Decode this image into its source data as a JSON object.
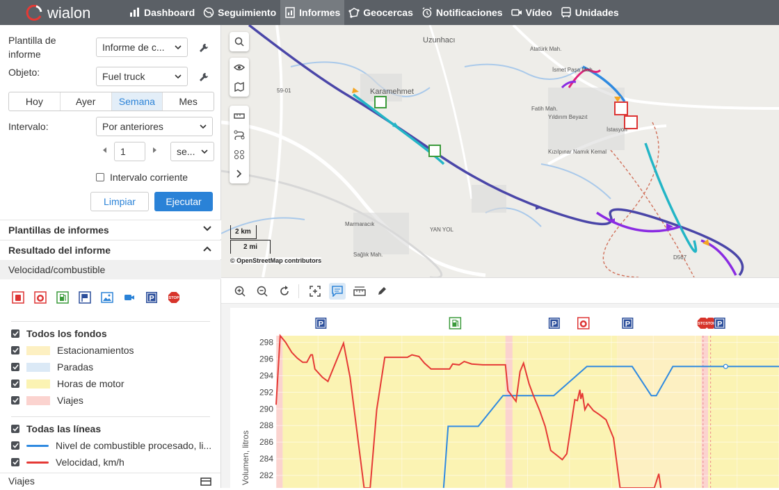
{
  "app": {
    "logo_text": "wialon"
  },
  "nav": [
    {
      "label": "Dashboard",
      "icon": "bar-chart-icon"
    },
    {
      "label": "Seguimiento",
      "icon": "globe-icon"
    },
    {
      "label": "Informes",
      "icon": "report-icon",
      "active": true
    },
    {
      "label": "Geocercas",
      "icon": "geofence-icon"
    },
    {
      "label": "Notificaciones",
      "icon": "alarm-icon"
    },
    {
      "label": "Vídeo",
      "icon": "video-icon"
    },
    {
      "label": "Unidades",
      "icon": "bus-icon"
    }
  ],
  "form": {
    "template_label": "Plantilla de informe",
    "template_value": "Informe de c...",
    "object_label": "Objeto:",
    "object_value": "Fuel truck",
    "periods": [
      "Hoy",
      "Ayer",
      "Semana",
      "Mes"
    ],
    "active_period": "Semana",
    "interval_label": "Intervalo:",
    "interval_value": "Por anteriores",
    "interval_count": "1",
    "interval_unit": "se...",
    "current_interval_label": "Intervalo corriente",
    "clear_label": "Limpiar",
    "run_label": "Ejecutar"
  },
  "sections": {
    "templates": "Plantillas de informes",
    "result": "Resultado del informe",
    "result_item": "Velocidad/combustible",
    "trips": "Viajes"
  },
  "event_icons": [
    "fuel-drain-icon",
    "fuel-sensor-icon",
    "fuel-station-icon",
    "flag-icon",
    "image-icon",
    "video-icon",
    "parking-icon",
    "stop-icon"
  ],
  "backgrounds": {
    "all_label": "Todos los fondos",
    "items": [
      {
        "label": "Estacionamientos",
        "color": "#fdf0c2"
      },
      {
        "label": "Paradas",
        "color": "#dbe9f6"
      },
      {
        "label": "Horas de motor",
        "color": "#fbf3b3"
      },
      {
        "label": "Viajes",
        "color": "#fbd3cf"
      }
    ]
  },
  "lines": {
    "all_label": "Todas las líneas",
    "items": [
      {
        "label": "Nivel de combustible procesado, li...",
        "color": "#2f8ae0"
      },
      {
        "label": "Velocidad, km/h",
        "color": "#e53935"
      }
    ]
  },
  "map": {
    "labels": [
      "Uzunhacı",
      "Karamehmet",
      "Atatürk Mah.",
      "İsmet Paşa Mah.",
      "Fatih Mah.",
      "Yıldırım Beyazıt",
      "İstasyon",
      "Kızılpınar Namık Kemal",
      "Marmaracık",
      "Sağlık Mah.",
      "59-01",
      "D567",
      "YAN YOL"
    ],
    "scale_km": "2 km",
    "scale_mi": "2 mi",
    "attribution": "© OpenStreetMap contributors"
  },
  "chart_data": {
    "type": "line",
    "ylabel": "Volumen, litros",
    "yticks": [
      282,
      284,
      286,
      288,
      290,
      292,
      294,
      296,
      298
    ],
    "ylim": [
      280.5,
      298.8
    ],
    "xlim": [
      0,
      100
    ],
    "series": [
      {
        "color": "#2f8ae0",
        "points": [
          [
            33.3,
            280.5
          ],
          [
            34.2,
            287.9
          ],
          [
            40.2,
            287.9
          ],
          [
            45.1,
            291.6
          ],
          [
            55.2,
            291.6
          ],
          [
            61.8,
            295.1
          ],
          [
            70.8,
            295.1
          ],
          [
            74.6,
            291.6
          ],
          [
            75.6,
            291.6
          ],
          [
            78.9,
            295.1
          ],
          [
            100,
            295.1
          ]
        ]
      },
      {
        "color": "#e53935",
        "points": [
          [
            0,
            290.5
          ],
          [
            0.8,
            298.8
          ],
          [
            1.9,
            298.0
          ],
          [
            3.1,
            296.8
          ],
          [
            4.2,
            296.1
          ],
          [
            5.3,
            295.6
          ],
          [
            6.1,
            295.6
          ],
          [
            6.9,
            296.5
          ],
          [
            7.2,
            296.5
          ],
          [
            7.7,
            294.8
          ],
          [
            9.2,
            293.8
          ],
          [
            10.3,
            293.3
          ],
          [
            13.4,
            297.9
          ],
          [
            14.7,
            293.8
          ],
          [
            17.5,
            280.5
          ],
          [
            18.7,
            280.5
          ],
          [
            20.0,
            289.9
          ],
          [
            21.6,
            296.2
          ],
          [
            26.1,
            296.2
          ],
          [
            27.0,
            296.5
          ],
          [
            28.4,
            296.3
          ],
          [
            29.5,
            295.5
          ],
          [
            30.8,
            294.8
          ],
          [
            31.6,
            294.8
          ],
          [
            34.5,
            294.8
          ],
          [
            35.1,
            295.4
          ],
          [
            36.4,
            295.3
          ],
          [
            37.4,
            295.7
          ],
          [
            38.9,
            295.4
          ],
          [
            41.1,
            295.3
          ],
          [
            45.6,
            295.3
          ],
          [
            46.1,
            292.2
          ],
          [
            47.7,
            290.9
          ],
          [
            48.5,
            294.5
          ],
          [
            49.2,
            295.5
          ],
          [
            50.3,
            293.0
          ],
          [
            51.1,
            291.7
          ],
          [
            52.4,
            289.8
          ],
          [
            53.5,
            287.9
          ],
          [
            54.6,
            285.0
          ],
          [
            56.9,
            283.9
          ],
          [
            57.8,
            284.6
          ],
          [
            59.4,
            291.1
          ],
          [
            59.9,
            291.0
          ],
          [
            60.4,
            292.3
          ],
          [
            60.6,
            291.2
          ],
          [
            60.9,
            291.9
          ],
          [
            61.4,
            289.9
          ],
          [
            62.0,
            290.6
          ],
          [
            63.1,
            289.8
          ],
          [
            64.3,
            289.3
          ],
          [
            65.6,
            288.7
          ],
          [
            67.1,
            286.5
          ],
          [
            68.4,
            280.5
          ],
          [
            75.2,
            280.5
          ],
          [
            76.1,
            282.2
          ],
          [
            76.5,
            280.5
          ]
        ]
      }
    ],
    "bands": [
      {
        "type": "Viajes",
        "from": 0.0,
        "to": 1.3
      },
      {
        "type": "Horas de motor",
        "from": 1.3,
        "to": 67.8
      },
      {
        "type": "Viajes",
        "from": 45.6,
        "to": 47.0
      },
      {
        "type": "Estacionamientos",
        "from": 67.8,
        "to": 84.6
      },
      {
        "type": "Viajes",
        "from": 84.6,
        "to": 85.9
      },
      {
        "type": "Horas de motor",
        "from": 85.9,
        "to": 100
      }
    ],
    "events": [
      {
        "icon": "parking-icon",
        "x": 8.9
      },
      {
        "icon": "fuel-station-icon",
        "x": 35.6
      },
      {
        "icon": "parking-icon",
        "x": 55.3
      },
      {
        "icon": "fuel-sensor-icon",
        "x": 61.1
      },
      {
        "icon": "parking-icon",
        "x": 69.9
      },
      {
        "icon": "stop-icon",
        "x": 84.9
      },
      {
        "icon": "stop-icon",
        "x": 86.4
      },
      {
        "icon": "parking-icon",
        "x": 88.2
      }
    ]
  }
}
